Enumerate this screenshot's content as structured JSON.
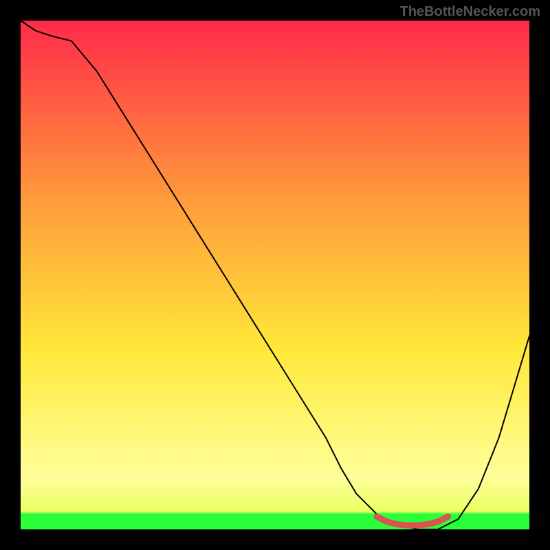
{
  "watermark": "TheBottleNecker.com",
  "chart_data": {
    "type": "line",
    "title": "",
    "xlabel": "",
    "ylabel": "",
    "xlim": [
      0,
      100
    ],
    "ylim": [
      0,
      100
    ],
    "background_gradient": {
      "top": "#ff2a4a",
      "mid1": "#ff9a3a",
      "mid2": "#ffe93a",
      "low": "#ffff9a",
      "bottom": "#2aff3a"
    },
    "series": [
      {
        "name": "bottleneck-curve",
        "color": "#000000",
        "x": [
          0,
          3,
          6,
          10,
          15,
          20,
          25,
          30,
          35,
          40,
          45,
          50,
          55,
          60,
          63,
          66,
          70,
          74,
          78,
          82,
          86,
          90,
          94,
          97,
          100
        ],
        "y": [
          100,
          98,
          97,
          96,
          90,
          82,
          74,
          66,
          58,
          50,
          42,
          34,
          26,
          18,
          12,
          7,
          3,
          1,
          0,
          0,
          2,
          8,
          18,
          28,
          38
        ]
      },
      {
        "name": "optimal-segment",
        "color": "#d9544d",
        "thick": true,
        "x": [
          70,
          72,
          74,
          76,
          78,
          80,
          82,
          84
        ],
        "y": [
          2.5,
          1.5,
          1,
          0.8,
          0.8,
          1,
          1.5,
          2.5
        ]
      }
    ]
  }
}
